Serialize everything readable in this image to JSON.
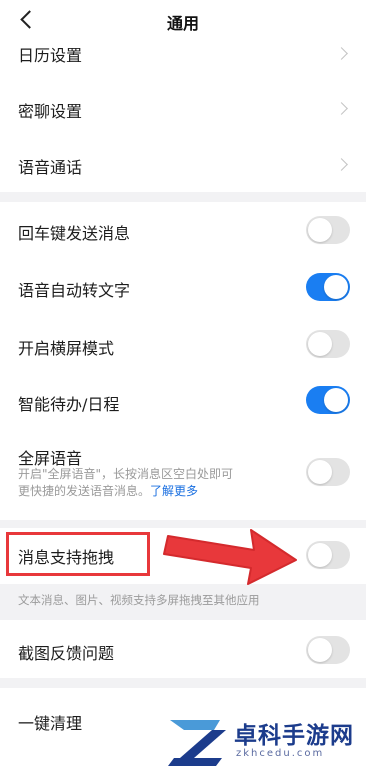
{
  "header": {
    "title": "通用"
  },
  "section1": [
    {
      "label": "日历设置"
    },
    {
      "label": "密聊设置"
    },
    {
      "label": "语音通话"
    }
  ],
  "section2": [
    {
      "label": "回车键发送消息",
      "on": false
    },
    {
      "label": "语音自动转文字",
      "on": true
    },
    {
      "label": "开启横屏模式",
      "on": false
    },
    {
      "label": "智能待办/日程",
      "on": true
    }
  ],
  "fullscreen_voice": {
    "label": "全屏语音",
    "desc_line1": "开启\"全屏语音\"，长按消息区空白处即可",
    "desc_line2": "更快捷的发送语音消息。",
    "link": "了解更多",
    "on": false
  },
  "drag_support": {
    "label": "消息支持拖拽",
    "on": false,
    "hint": "文本消息、图片、视频支持多屏拖拽至其他应用"
  },
  "screenshot_feedback": {
    "label": "截图反馈问题",
    "on": false
  },
  "one_click_clean": {
    "label": "一键清理"
  },
  "colors": {
    "accent": "#1a7ef2",
    "annotation_red": "#e8383b"
  },
  "watermark": {
    "name": "卓科手游网",
    "domain": "zkhcedu.com"
  }
}
